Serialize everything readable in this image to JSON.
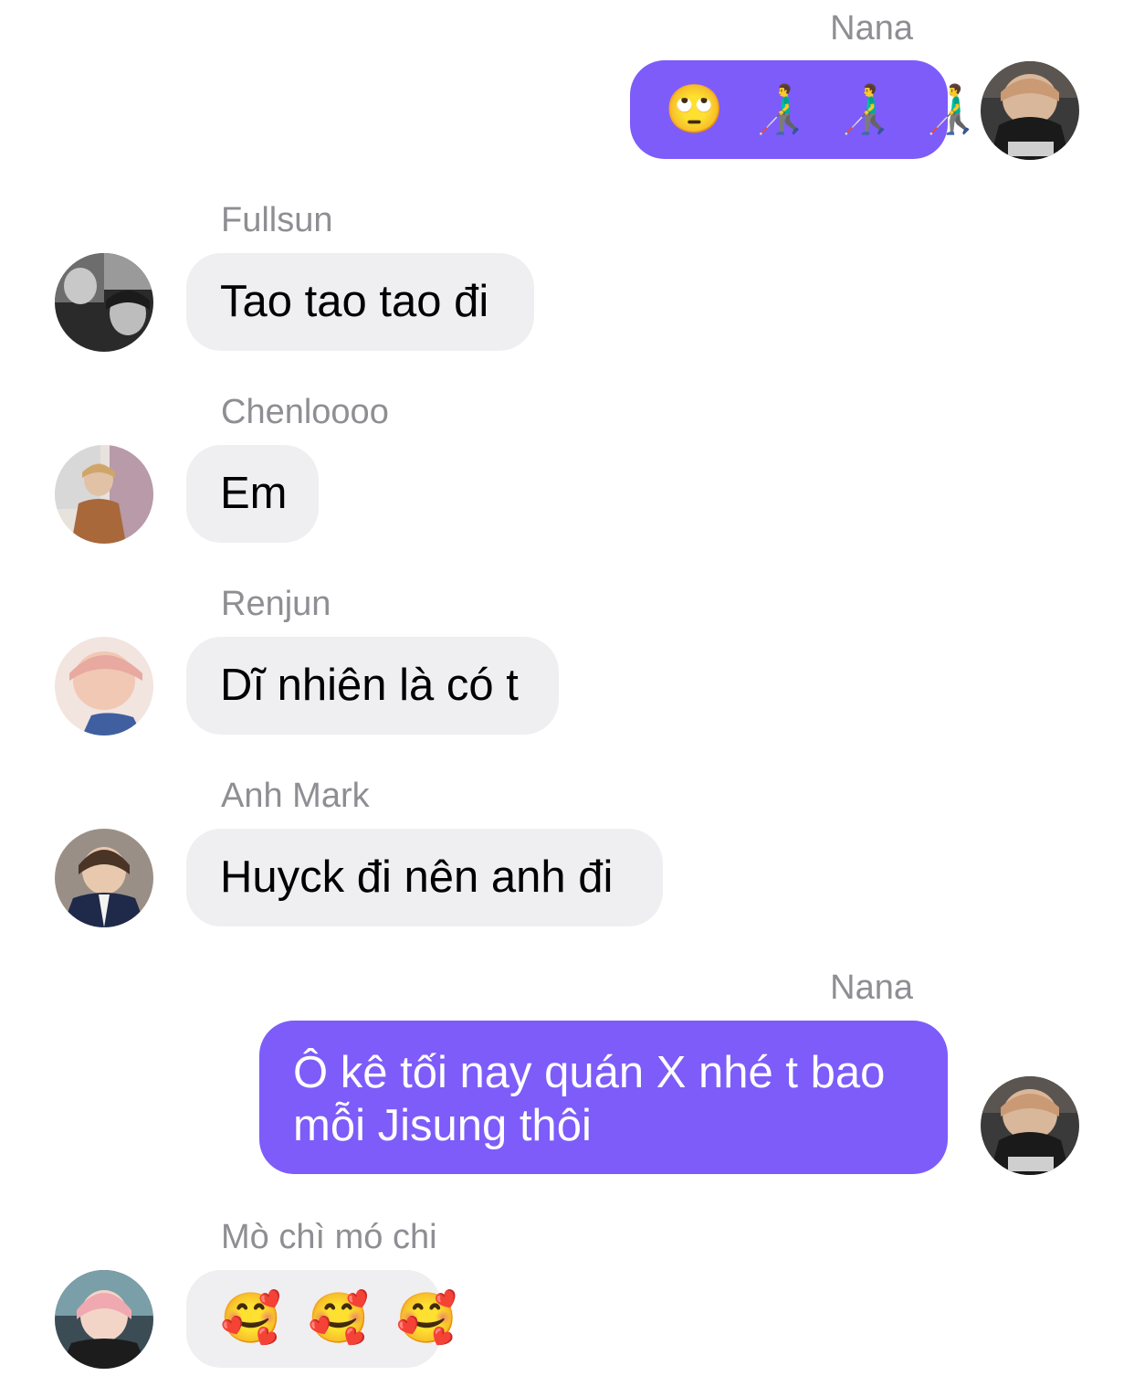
{
  "messages": [
    {
      "sender": "Nana",
      "text": "🙄 👨‍🦯 👨‍🦯 👨‍🦯"
    },
    {
      "sender": "Fullsun",
      "text": "Tao tao tao đi"
    },
    {
      "sender": "Chenloooo",
      "text": "Em"
    },
    {
      "sender": "Renjun",
      "text": "Dĩ nhiên là có t"
    },
    {
      "sender": "Anh Mark",
      "text": "Huyck đi nên anh đi"
    },
    {
      "sender": "Nana",
      "text": "Ô kê tối nay quán X nhé t bao mỗi Jisung thôi"
    },
    {
      "sender": "Mò chì mó chi",
      "text": "🥰 🥰 🥰"
    }
  ],
  "colors": {
    "outgoing_bubble": "#7d5cfa",
    "incoming_bubble": "#efeff1",
    "sender_name": "#8e8e93"
  }
}
